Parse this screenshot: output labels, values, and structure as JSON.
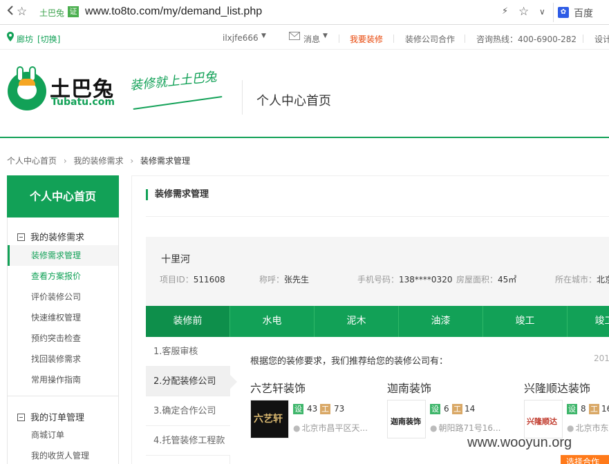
{
  "browser": {
    "site_name": "土巴兔",
    "cert_badge": "证",
    "url": "www.to8to.com/my/demand_list.php",
    "search_engine": "百度",
    "icons": [
      "back-icon",
      "star-icon",
      "lightning-icon",
      "bookmark-star-icon",
      "dropdown-icon",
      "baidu-paw-icon"
    ]
  },
  "topnav": {
    "city": "廊坊",
    "switch": "[切换]",
    "username": "ilxjfe666",
    "messages": "消息",
    "want_decor": "我要装修",
    "cooperation": "装修公司合作",
    "hotline": "咨询热线：400-6900-282",
    "design": "设计"
  },
  "header": {
    "logo_cn": "土巴兔",
    "logo_en": "Tubatu.com",
    "slogan": "装修就上土巴兔",
    "title": "个人中心首页"
  },
  "breadcrumb": {
    "items": [
      "个人中心首页",
      "我的装修需求",
      "装修需求管理"
    ]
  },
  "sidebar": {
    "head": "个人中心首页",
    "group1": "我的装修需求",
    "group1_items": [
      "装修需求管理",
      "查看方案报价",
      "评价装修公司",
      "快速维权管理",
      "预约突击检查",
      "找回装修需求",
      "常用操作指南"
    ],
    "group2": "我的订单管理",
    "group2_items": [
      "商城订单",
      "我的收货人管理"
    ]
  },
  "main": {
    "title": "装修需求管理",
    "project": {
      "name": "十里河",
      "id_label": "项目ID：",
      "id_value": "511608",
      "contact_label": "称呼：",
      "contact_value": "张先生",
      "phone_label": "手机号码：",
      "phone_value": "138****0320",
      "area_label": "房屋面积：",
      "area_value": "45㎡",
      "city_label": "所在城市：",
      "city_value": "北京"
    },
    "steps": [
      "装修前",
      "水电",
      "泥木",
      "油漆",
      "竣工",
      "竣工后"
    ],
    "substeps": [
      "1.客服审核",
      "2.分配装修公司",
      "3.确定合作公司",
      "4.托管装修工程款"
    ],
    "recommend_text": "根据您的装修要求，我们推荐给您的装修公司有：",
    "recommend_date": "201",
    "companies": [
      {
        "name": "六艺轩装饰",
        "logo_text": "六艺轩",
        "design": "43",
        "work": "73",
        "addr": "北京市昌平区天..."
      },
      {
        "name": "迦南装饰",
        "logo_text": "迦南装饰",
        "design": "6",
        "work": "14",
        "addr": "朝阳路71号16..."
      },
      {
        "name": "兴隆顺达装饰",
        "logo_text": "兴隆顺达",
        "design": "8",
        "work": "16",
        "addr": "北京市东"
      }
    ],
    "tag_design": "设",
    "tag_work": "工",
    "select_button": "选择合作"
  },
  "watermark": "www.wooyun.org",
  "colors": {
    "brand_green": "#12a157",
    "accent_orange": "#ff7a1a",
    "nav_red": "#e8470a"
  }
}
